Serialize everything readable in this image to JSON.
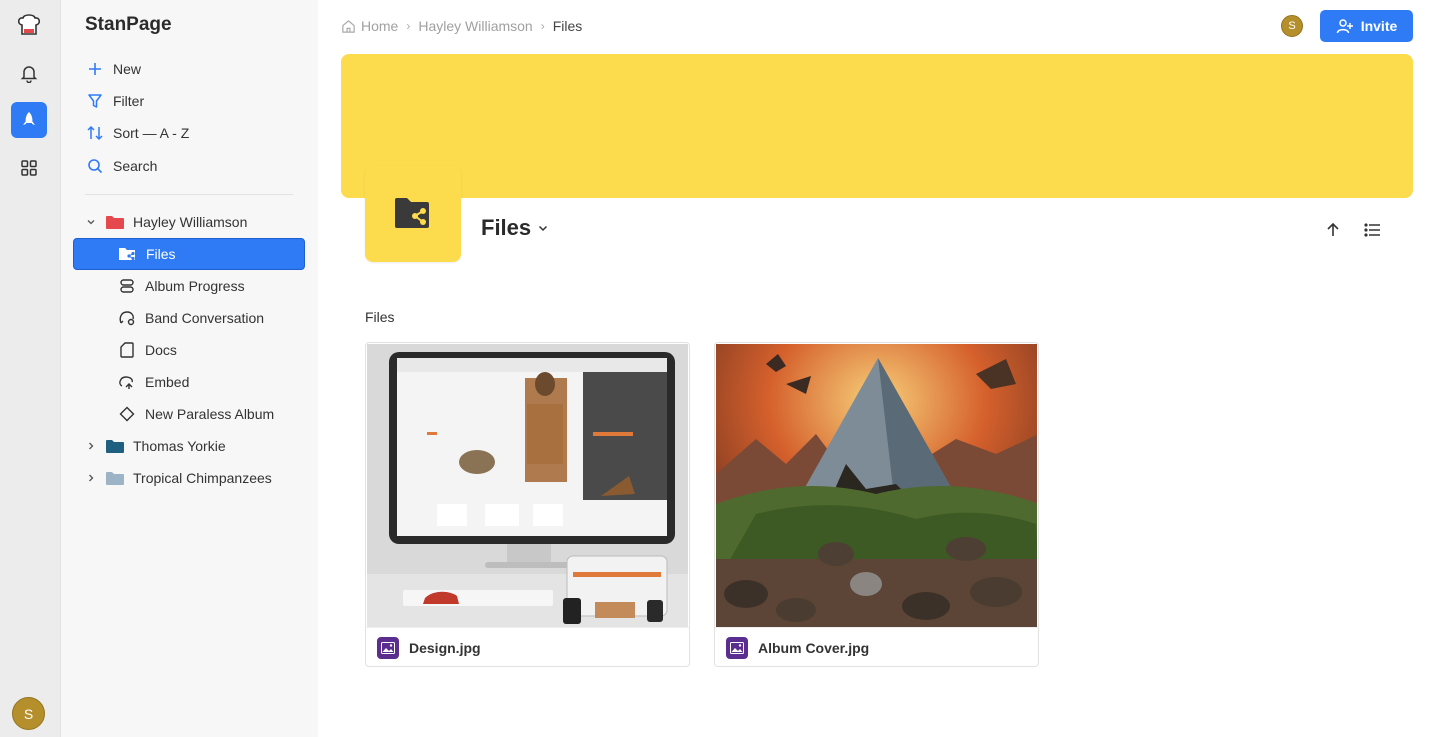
{
  "app": {
    "name": "StanPage"
  },
  "rail": {
    "items": [
      {
        "icon": "chef-hat-logo-icon"
      },
      {
        "icon": "bell-icon"
      },
      {
        "icon": "rocket-icon",
        "active": true
      },
      {
        "icon": "grid-icon"
      }
    ],
    "user_initial": "S"
  },
  "sidebar": {
    "actions": [
      {
        "label": "New",
        "icon": "plus-icon"
      },
      {
        "label": "Filter",
        "icon": "filter-icon"
      },
      {
        "label": "Sort — A - Z",
        "icon": "sort-icon"
      },
      {
        "label": "Search",
        "icon": "search-icon"
      }
    ],
    "tree": [
      {
        "label": "Hayley Williamson",
        "folder_color": "#e5484d",
        "expanded": true
      },
      {
        "label": "Files",
        "icon": "folder-share-icon",
        "selected": true
      },
      {
        "label": "Album Progress",
        "icon": "progress-icon"
      },
      {
        "label": "Band Conversation",
        "icon": "conversation-icon"
      },
      {
        "label": "Docs",
        "icon": "doc-icon"
      },
      {
        "label": "Embed",
        "icon": "embed-icon"
      },
      {
        "label": "New Paraless Album",
        "icon": "diamond-icon"
      },
      {
        "label": "Thomas Yorkie",
        "folder_color": "#1f5f7f",
        "expanded": false
      },
      {
        "label": "Tropical Chimpanzees",
        "folder_color": "#9db4c6",
        "expanded": false
      }
    ]
  },
  "header": {
    "breadcrumb": [
      "Home",
      "Hayley Williamson",
      "Files"
    ],
    "user_initial": "S",
    "invite_label": "Invite"
  },
  "page": {
    "title": "Files",
    "cover_color": "#fcdc4d",
    "section_label": "Files",
    "files": [
      {
        "name": "Design.jpg"
      },
      {
        "name": "Album Cover.jpg"
      }
    ]
  },
  "colors": {
    "accent": "#2f7bf5",
    "image_badge": "#5b2d8e"
  }
}
